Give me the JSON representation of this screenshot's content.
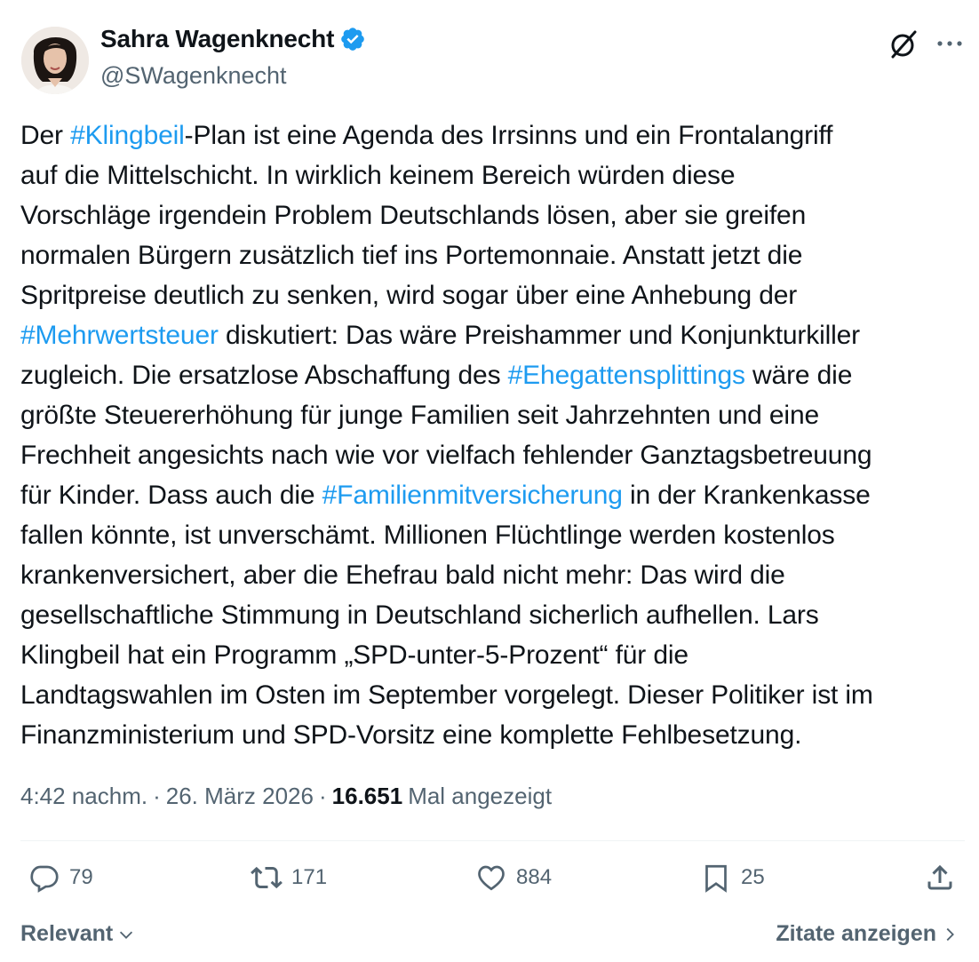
{
  "author": {
    "name": "Sahra Wagenknecht",
    "handle": "@SWagenknecht"
  },
  "tweet": {
    "segments": [
      {
        "text": "Der ",
        "tag": false
      },
      {
        "text": "#Klingbeil",
        "tag": true
      },
      {
        "text": "-Plan ist eine Agenda des Irrsinns und ein Frontalangriff\nauf die Mittelschicht. In wirklich keinem Bereich würden diese\nVorschläge irgendein Problem Deutschlands lösen, aber sie greifen\nnormalen Bürgern zusätzlich tief ins Portemonnaie. Anstatt jetzt die\nSpritpreise deutlich zu senken, wird sogar über eine Anhebung der\n",
        "tag": false
      },
      {
        "text": "#Mehrwertsteuer",
        "tag": true
      },
      {
        "text": " diskutiert: Das wäre Preishammer und Konjunkturkiller\nzugleich. Die ersatzlose Abschaffung des ",
        "tag": false
      },
      {
        "text": "#Ehegattensplittings",
        "tag": true
      },
      {
        "text": " wäre die\ngrößte Steuererhöhung für junge Familien seit Jahrzehnten und eine\nFrechheit angesichts nach wie vor vielfach fehlender Ganztagsbetreuung\nfür Kinder. Dass auch die ",
        "tag": false
      },
      {
        "text": "#Familienmitversicherung",
        "tag": true
      },
      {
        "text": " in der Krankenkasse\nfallen könnte, ist unverschämt. Millionen Flüchtlinge werden kostenlos\nkrankenversichert, aber die Ehefrau bald nicht mehr: Das wird die\ngesellschaftliche Stimmung in Deutschland sicherlich aufhellen. Lars\nKlingbeil hat ein Programm „SPD-unter-5-Prozent“ für die\nLandtagswahlen im Osten im September vorgelegt. Dieser Politiker ist im\nFinanzministerium und SPD-Vorsitz eine komplette Fehlbesetzung.",
        "tag": false
      }
    ]
  },
  "meta": {
    "time": "4:42 nachm.",
    "sep1": "·",
    "date": "26. März 2026",
    "sep2": "·",
    "views": "16.651",
    "views_label": "Mal angezeigt"
  },
  "actions": {
    "replies": "79",
    "reposts": "171",
    "likes": "884",
    "bookmarks": "25"
  },
  "bottom": {
    "sort_label": "Relevant",
    "quotes_label": "Zitate anzeigen"
  },
  "colors": {
    "accent": "#1d9bf0",
    "secondary_text": "#536471",
    "primary_text": "#0f1419"
  },
  "icons": [
    "verified-badge-icon",
    "grok-icon",
    "more-icon",
    "reply-icon",
    "repost-icon",
    "like-icon",
    "bookmark-icon",
    "share-icon",
    "chevron-down-icon",
    "chevron-right-icon"
  ]
}
